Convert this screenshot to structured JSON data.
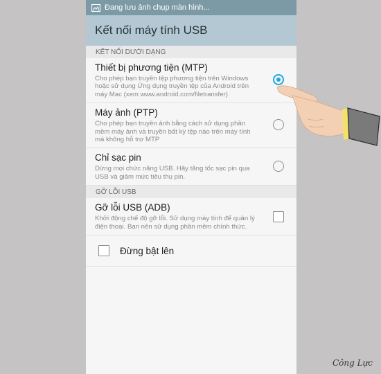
{
  "status_bar": {
    "icon": "image-icon",
    "text": "Đang lưu ảnh chụp màn hình..."
  },
  "app_bar": {
    "title": "Kết nối máy tính USB"
  },
  "sections": {
    "connect_as": {
      "header": "KẾT NỐI DƯỚI DẠNG"
    },
    "debug": {
      "header": "GỠ LỖI USB"
    }
  },
  "options": [
    {
      "title": "Thiết bị phương tiện (MTP)",
      "desc": "Cho phép bạn truyền tệp phương tiện trên Windows hoặc sử dụng Ứng dụng truyền tệp của Android trên máy Mac (xem www.android.com/filetransfer)",
      "selected": true
    },
    {
      "title": "Máy ảnh (PTP)",
      "desc": "Cho phép bạn truyền ảnh bằng cách sử dụng phần mềm máy ảnh và truyền bất kỳ tệp nào trên máy tính mà không hỗ trợ MTP",
      "selected": false
    },
    {
      "title": "Chỉ sạc pin",
      "desc": "Dừng mọi chức năng USB. Hãy tăng tốc sạc pin qua USB và giảm mức tiêu thụ pin.",
      "selected": false
    }
  ],
  "adb": {
    "title": "Gỡ lỗi USB (ADB)",
    "desc": "Khởi động chế độ gỡ lỗi. Sử dụng máy tính để quản lý điện thoại. Bạn nên sử dụng phần mềm chính thức.",
    "checked": false
  },
  "dont_show": {
    "label": "Đừng bật lên",
    "checked": false
  },
  "watermark": "Công Lực",
  "colors": {
    "accent": "#1ea8dd",
    "app_bar": "#b3c8d2",
    "status_bar": "#7c9aa6"
  }
}
